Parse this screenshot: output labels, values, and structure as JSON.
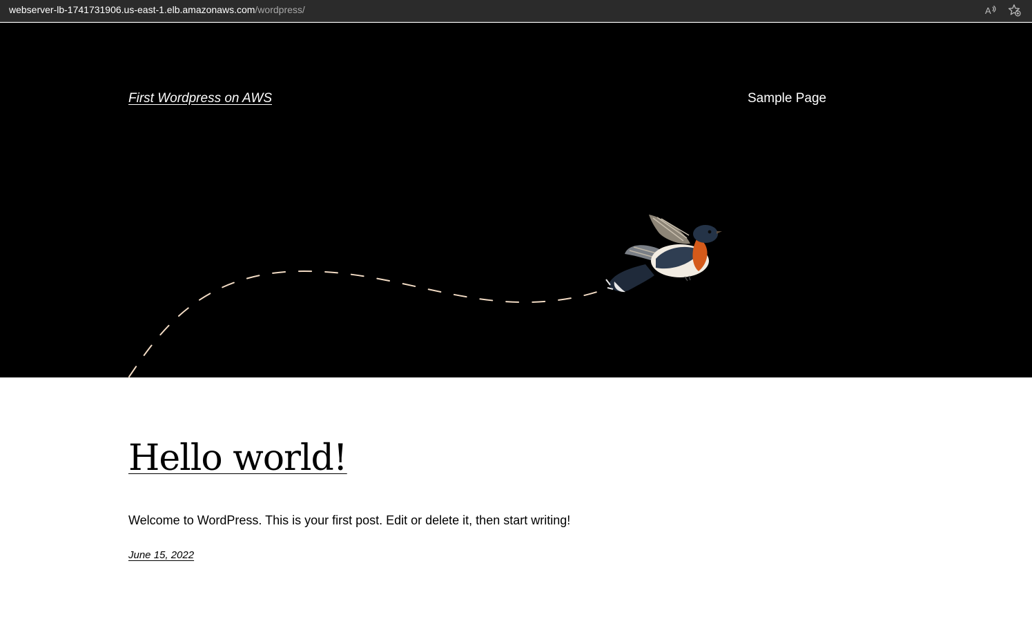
{
  "browser": {
    "url_host": "webserver-lb-1741731906.us-east-1.elb.amazonaws.com",
    "url_path": "/wordpress/",
    "icons": [
      "read-aloud-icon",
      "favorite-add-icon"
    ]
  },
  "header": {
    "site_title": "First Wordpress on AWS",
    "nav_items": [
      {
        "label": "Sample Page"
      }
    ],
    "colors": {
      "background": "#000000",
      "text": "#ffffff",
      "dash": "#f3dcc5"
    }
  },
  "post": {
    "title": "Hello world!",
    "excerpt": "Welcome to WordPress. This is your first post. Edit or delete it, then start writing!",
    "date": "June 15, 2022"
  }
}
